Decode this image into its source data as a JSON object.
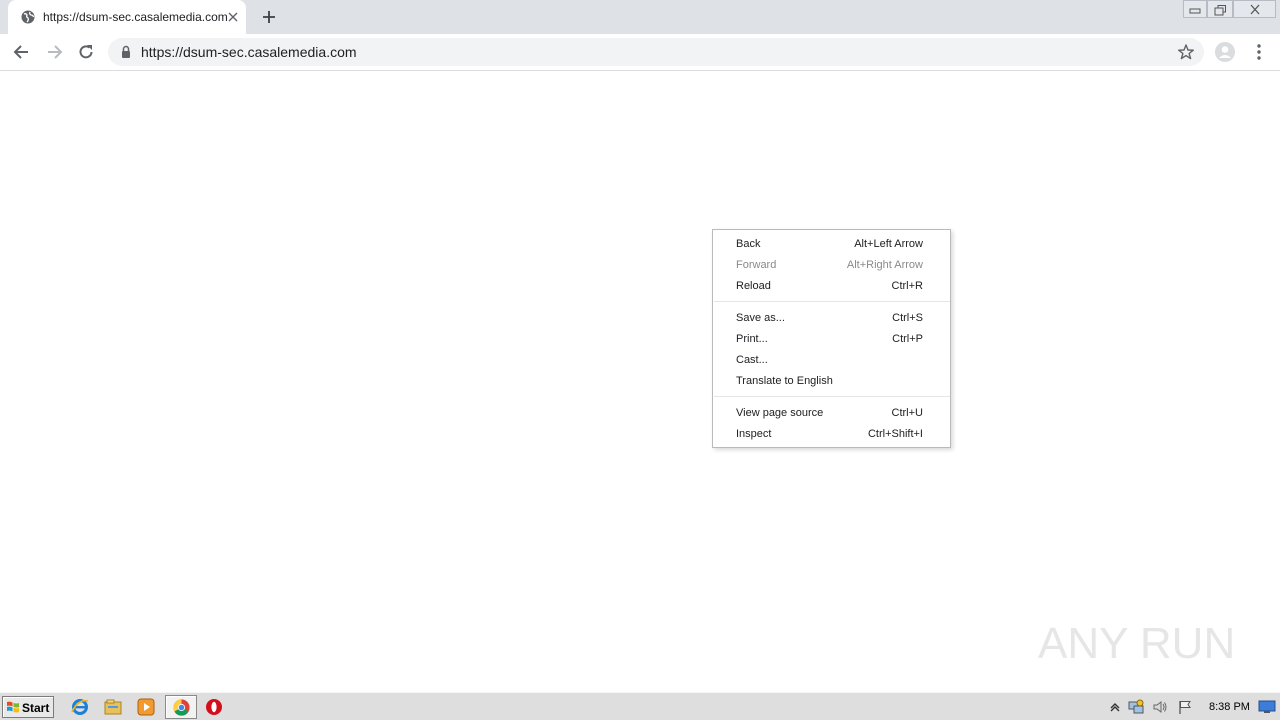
{
  "browser": {
    "tab": {
      "title": "https://dsum-sec.casalemedia.com",
      "favicon": "globe-icon",
      "close_icon": "close-icon"
    },
    "new_tab_icon": "plus-icon",
    "window_controls": [
      "minimize-icon",
      "restore-icon",
      "close-icon"
    ],
    "toolbar": {
      "back_icon": "arrow-left-icon",
      "forward_icon": "arrow-right-icon",
      "reload_icon": "reload-icon",
      "lock_icon": "lock-icon",
      "url": "https://dsum-sec.casalemedia.com",
      "bookmark_icon": "star-icon",
      "profile_icon": "avatar-icon",
      "menu_icon": "kebab-menu-icon"
    }
  },
  "context_menu": {
    "groups": [
      [
        {
          "label": "Back",
          "shortcut": "Alt+Left Arrow",
          "enabled": true
        },
        {
          "label": "Forward",
          "shortcut": "Alt+Right Arrow",
          "enabled": false
        },
        {
          "label": "Reload",
          "shortcut": "Ctrl+R",
          "enabled": true
        }
      ],
      [
        {
          "label": "Save as...",
          "shortcut": "Ctrl+S",
          "enabled": true
        },
        {
          "label": "Print...",
          "shortcut": "Ctrl+P",
          "enabled": true
        },
        {
          "label": "Cast...",
          "shortcut": "",
          "enabled": true
        },
        {
          "label": "Translate to English",
          "shortcut": "",
          "enabled": true
        }
      ],
      [
        {
          "label": "View page source",
          "shortcut": "Ctrl+U",
          "enabled": true
        },
        {
          "label": "Inspect",
          "shortcut": "Ctrl+Shift+I",
          "enabled": true
        }
      ]
    ]
  },
  "watermark": {
    "text": "ANY RUN"
  },
  "taskbar": {
    "start_label": "Start",
    "pinned": [
      "internet-explorer-icon",
      "file-explorer-icon",
      "media-player-icon",
      "chrome-icon",
      "opera-icon"
    ],
    "tray_icons": [
      "show-hidden-icons-icon",
      "network-icon",
      "volume-icon",
      "action-center-flag-icon"
    ],
    "clock": "8:38 PM",
    "show_desktop_icon": "show-desktop-icon"
  },
  "colors": {
    "tabstrip": "#dee1e6",
    "omnibox": "#f1f3f4",
    "taskbar": "#dedede",
    "disabled_text": "#8a8a8a"
  }
}
